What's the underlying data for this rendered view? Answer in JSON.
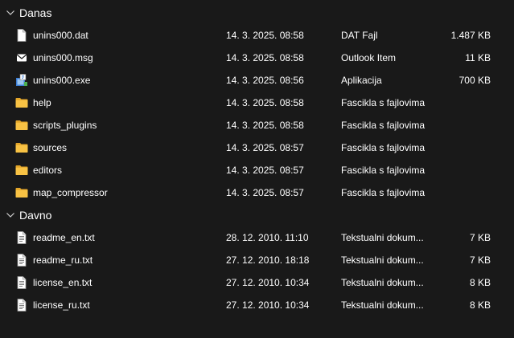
{
  "groups": [
    {
      "title": "Danas",
      "rows": [
        {
          "icon": "document-icon",
          "name": "unins000.dat",
          "date": "14. 3. 2025. 08:58",
          "type": "DAT Fajl",
          "size": "1.487 KB"
        },
        {
          "icon": "envelope-icon",
          "name": "unins000.msg",
          "date": "14. 3. 2025. 08:58",
          "type": "Outlook Item",
          "size": "11 KB"
        },
        {
          "icon": "installer-icon",
          "name": "unins000.exe",
          "date": "14. 3. 2025. 08:56",
          "type": "Aplikacija",
          "size": "700 KB"
        },
        {
          "icon": "folder-icon",
          "name": "help",
          "date": "14. 3. 2025. 08:58",
          "type": "Fascikla s fajlovima",
          "size": ""
        },
        {
          "icon": "folder-icon",
          "name": "scripts_plugins",
          "date": "14. 3. 2025. 08:58",
          "type": "Fascikla s fajlovima",
          "size": ""
        },
        {
          "icon": "folder-icon",
          "name": "sources",
          "date": "14. 3. 2025. 08:57",
          "type": "Fascikla s fajlovima",
          "size": ""
        },
        {
          "icon": "folder-icon",
          "name": "editors",
          "date": "14. 3. 2025. 08:57",
          "type": "Fascikla s fajlovima",
          "size": ""
        },
        {
          "icon": "folder-icon",
          "name": "map_compressor",
          "date": "14. 3. 2025. 08:57",
          "type": "Fascikla s fajlovima",
          "size": ""
        }
      ]
    },
    {
      "title": "Davno",
      "rows": [
        {
          "icon": "text-file-icon",
          "name": "readme_en.txt",
          "date": "28. 12. 2010. 11:10",
          "type": "Tekstualni dokum...",
          "size": "7 KB"
        },
        {
          "icon": "text-file-icon",
          "name": "readme_ru.txt",
          "date": "27. 12. 2010. 18:18",
          "type": "Tekstualni dokum...",
          "size": "7 KB"
        },
        {
          "icon": "text-file-icon",
          "name": "license_en.txt",
          "date": "27. 12. 2010. 10:34",
          "type": "Tekstualni dokum...",
          "size": "8 KB"
        },
        {
          "icon": "text-file-icon",
          "name": "license_ru.txt",
          "date": "27. 12. 2010. 10:34",
          "type": "Tekstualni dokum...",
          "size": "8 KB"
        }
      ]
    }
  ],
  "colors": {
    "background": "#191919",
    "text": "#ffffff",
    "folder": "#f8c244",
    "folder_dark": "#e2a529"
  }
}
